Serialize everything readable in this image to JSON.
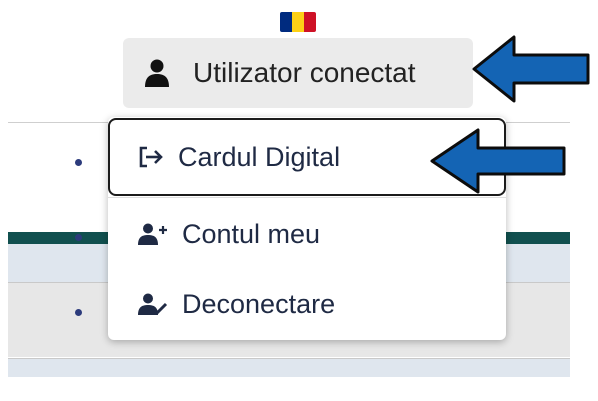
{
  "header": {
    "flag_colors": [
      "#002B7F",
      "#FCD116",
      "#CE1126"
    ],
    "user_button_label": "Utilizator conectat",
    "user_icon": "user-icon"
  },
  "menu": {
    "items": [
      {
        "label": "Cardul Digital",
        "icon": "sign-in-arrow-icon"
      },
      {
        "label": "Contul meu",
        "icon": "user-plus-icon"
      },
      {
        "label": "Deconectare",
        "icon": "user-pen-icon"
      }
    ]
  },
  "annotations": {
    "arrow_color": "#1464b4"
  }
}
